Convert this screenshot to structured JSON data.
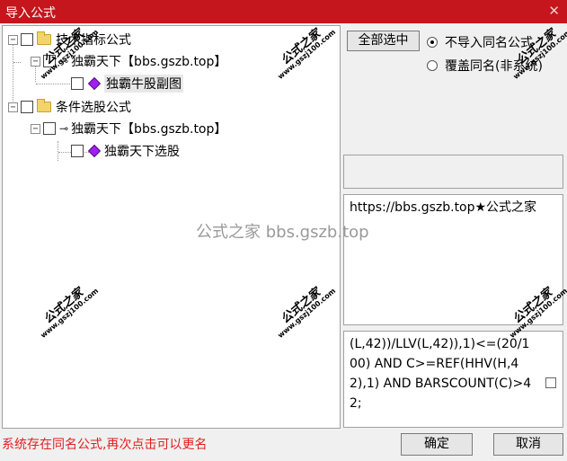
{
  "window": {
    "title": "导入公式",
    "close_glyph": "✕"
  },
  "tree": {
    "nodes": [
      {
        "label": "技术指标公式",
        "kind": "folder",
        "expander": "−"
      },
      {
        "label": "独霸天下【bbs.gszb.top】",
        "kind": "key",
        "expander": "−"
      },
      {
        "label": "独霸牛股副图",
        "kind": "formula"
      },
      {
        "label": "条件选股公式",
        "kind": "folder",
        "expander": "−"
      },
      {
        "label": "独霸天下【bbs.gszb.top】",
        "kind": "key",
        "expander": "−"
      },
      {
        "label": "独霸天下选股",
        "kind": "formula"
      }
    ]
  },
  "actions": {
    "select_all": "全部选中",
    "options": [
      {
        "label": "不导入同名公式",
        "selected": true
      },
      {
        "label": "覆盖同名(非系统)",
        "selected": false
      }
    ]
  },
  "description": "https://bbs.gszb.top★公式之家",
  "formula_text": "(L,42))/LLV(L,42)),1)<=(20/100) AND C>=REF(HHV(H,42),1) AND BARSCOUNT(C)>42;",
  "status_message": "系统存在同名公式,再次点击可以更名",
  "buttons": {
    "ok": "确定",
    "cancel": "取消"
  },
  "watermarks": {
    "cn": "公式之家",
    "url": "www.gszj100.com",
    "center": "公式之家 bbs.gszb.top"
  },
  "colors": {
    "titlebar": "#c4161c",
    "status_text": "#e02020",
    "formula_icon": "#a020f0"
  }
}
